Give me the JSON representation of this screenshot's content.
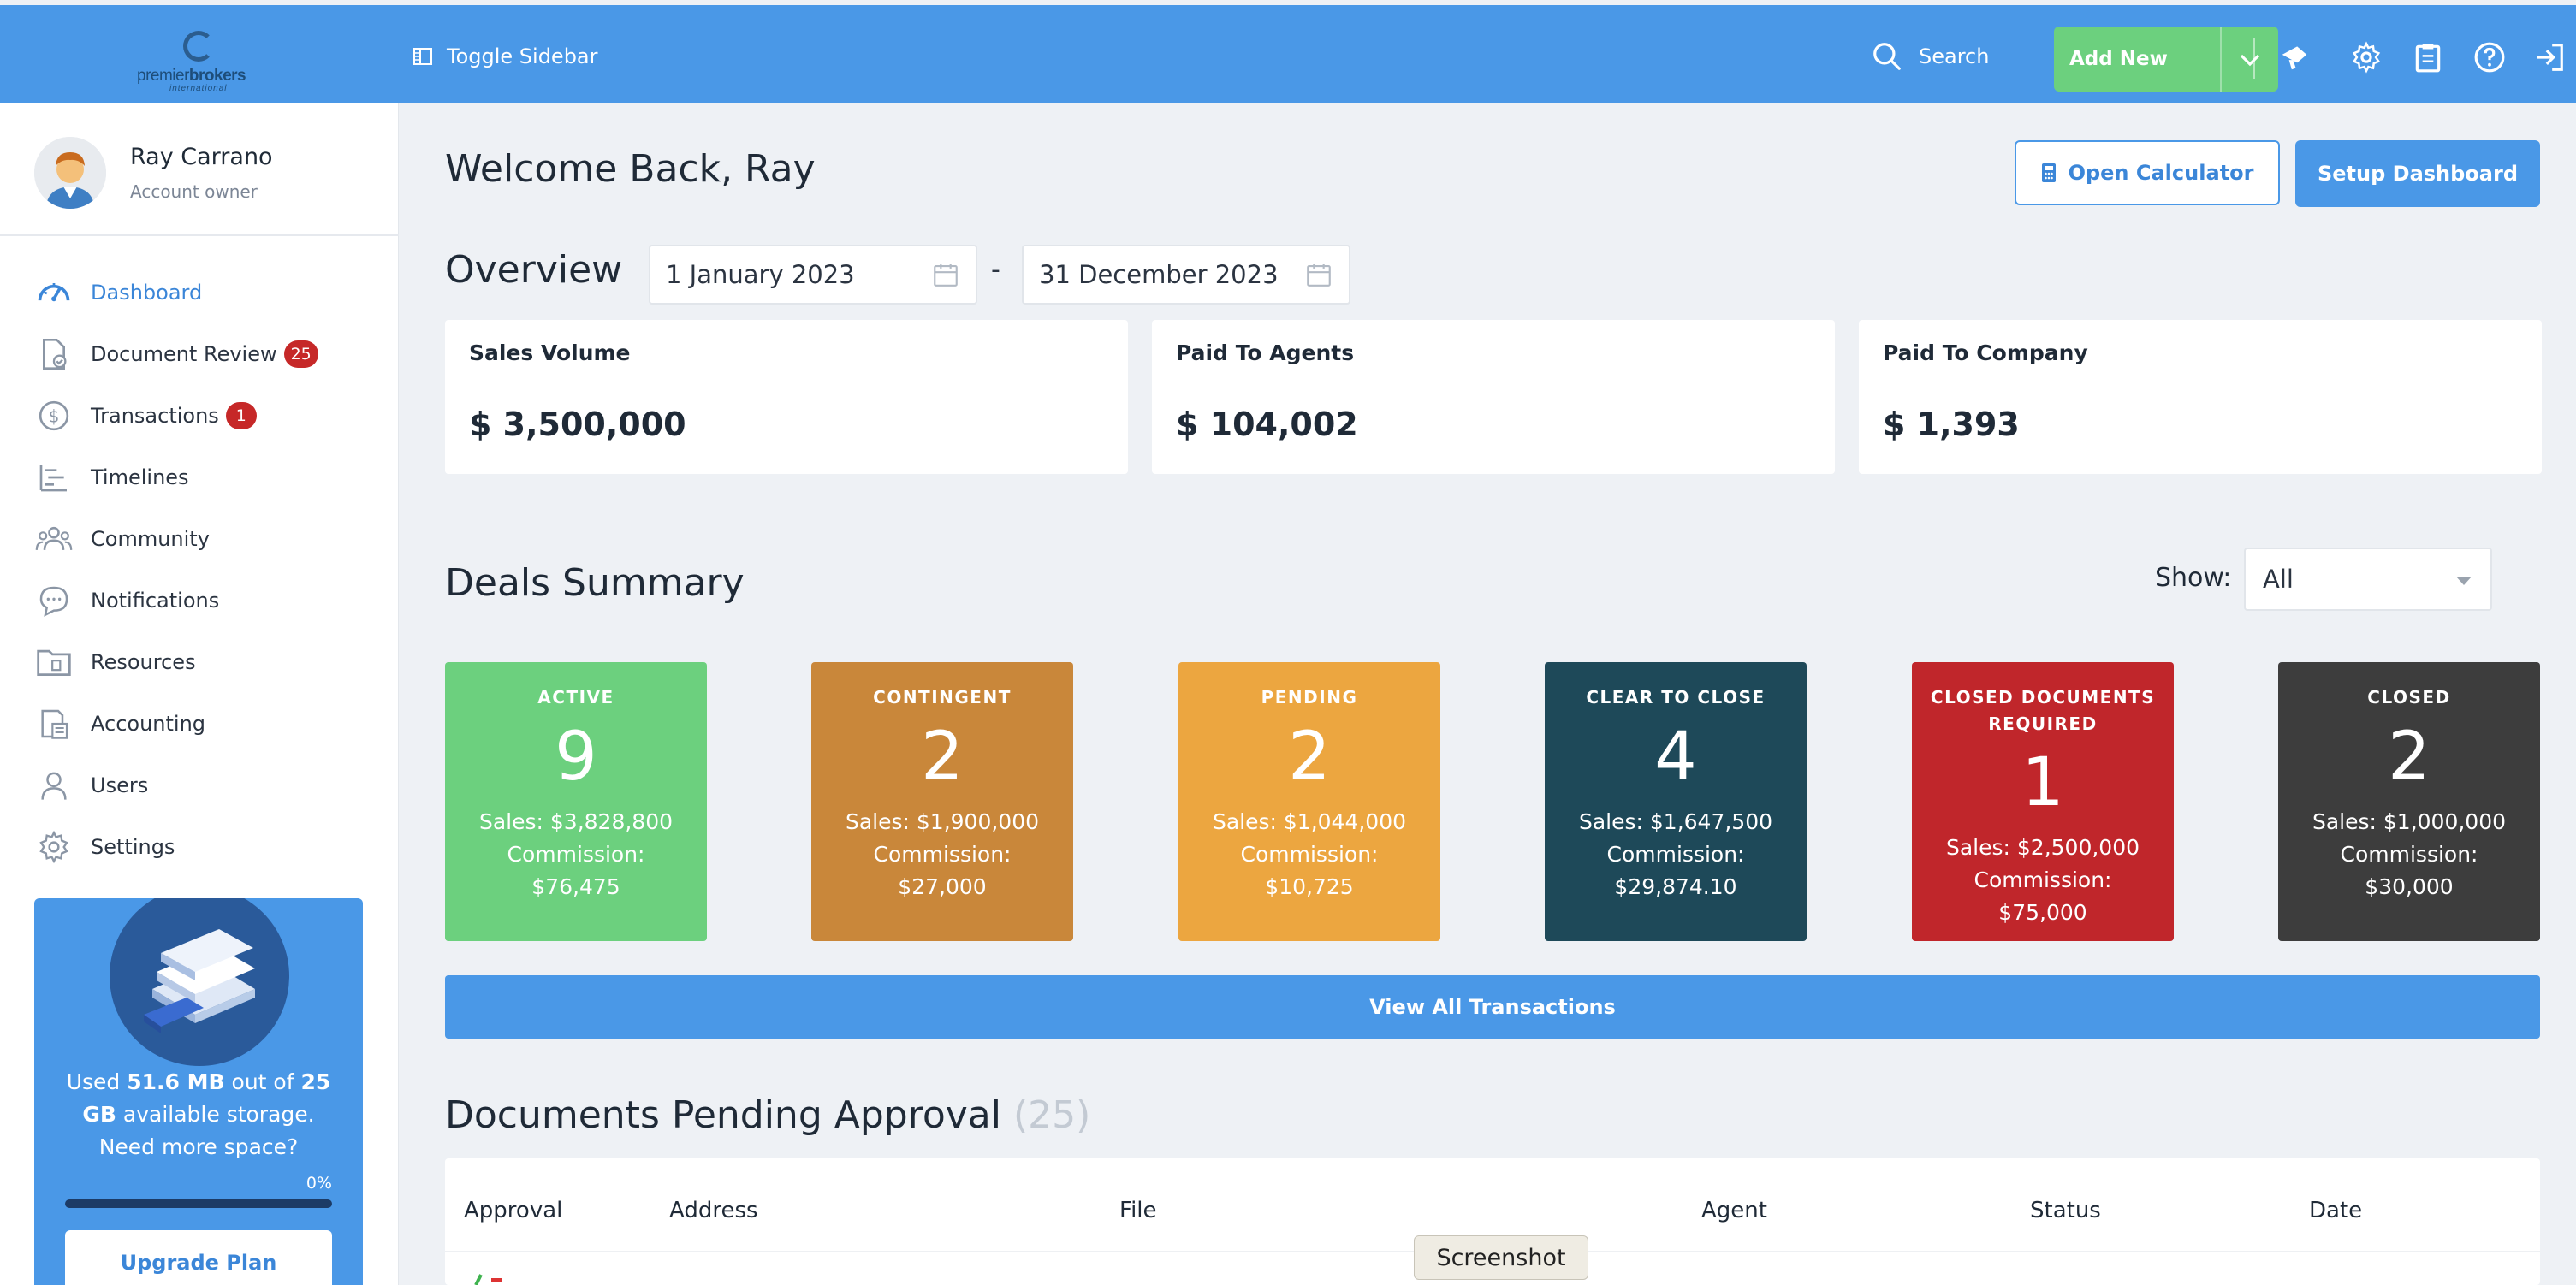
{
  "topbar": {
    "logo": {
      "word_light": "premier",
      "word_bold": "brokers",
      "sub": "international"
    },
    "toggle_sidebar_label": "Toggle Sidebar",
    "search_label": "Search",
    "add_new_label": "Add New",
    "icons": [
      "megaphone-icon",
      "gear-icon",
      "clipboard-icon",
      "help-icon",
      "logout-icon"
    ]
  },
  "user": {
    "name": "Ray Carrano",
    "role": "Account owner"
  },
  "sidebar": {
    "items": [
      {
        "label": "Dashboard",
        "icon": "dashboard-icon",
        "active": true
      },
      {
        "label": "Document Review",
        "icon": "document-check-icon",
        "badge": "25"
      },
      {
        "label": "Transactions",
        "icon": "dollar-circle-icon",
        "badge": "1"
      },
      {
        "label": "Timelines",
        "icon": "timeline-icon"
      },
      {
        "label": "Community",
        "icon": "community-icon"
      },
      {
        "label": "Notifications",
        "icon": "chat-bubble-icon"
      },
      {
        "label": "Resources",
        "icon": "folder-icon"
      },
      {
        "label": "Accounting",
        "icon": "accounting-icon"
      },
      {
        "label": "Users",
        "icon": "user-icon"
      },
      {
        "label": "Settings",
        "icon": "gear-icon"
      }
    ],
    "storage": {
      "used_prefix": "Used ",
      "used": "51.6 MB",
      "middle": " out of ",
      "total": "25 GB",
      "suffix": " available storage.",
      "question": "Need more space?",
      "percent": "0%",
      "percent_value": 0,
      "upgrade_label": "Upgrade Plan"
    }
  },
  "main": {
    "welcome": "Welcome Back, Ray",
    "open_calculator_label": "Open Calculator",
    "setup_dashboard_label": "Setup Dashboard",
    "overview_title": "Overview",
    "date_from": "1 January 2023",
    "date_separator": "-",
    "date_to": "31 December 2023",
    "stats": [
      {
        "label": "Sales Volume",
        "value": "$ 3,500,000"
      },
      {
        "label": "Paid To Agents",
        "value": "$ 104,002"
      },
      {
        "label": "Paid To Company",
        "value": "$ 1,393"
      }
    ],
    "deals_title": "Deals Summary",
    "show_label": "Show:",
    "show_value": "All",
    "deals": [
      {
        "label": "ACTIVE",
        "count": "9",
        "sales": "Sales: $3,828,800",
        "commission_label": "Commission:",
        "commission": "$76,475",
        "color": "#6cd07e"
      },
      {
        "label": "CONTINGENT",
        "count": "2",
        "sales": "Sales: $1,900,000",
        "commission_label": "Commission:",
        "commission": "$27,000",
        "color": "#c9873a"
      },
      {
        "label": "PENDING",
        "count": "2",
        "sales": "Sales: $1,044,000",
        "commission_label": "Commission:",
        "commission": "$10,725",
        "color": "#eca640"
      },
      {
        "label": "CLEAR TO CLOSE",
        "count": "4",
        "sales": "Sales: $1,647,500",
        "commission_label": "Commission:",
        "commission": "$29,874.10",
        "color": "#1e4959"
      },
      {
        "label": "CLOSED DOCUMENTS REQUIRED",
        "count": "1",
        "sales": "Sales: $2,500,000",
        "commission_label": "Commission:",
        "commission": "$75,000",
        "color": "#c0262b"
      },
      {
        "label": "CLOSED",
        "count": "2",
        "sales": "Sales: $1,000,000",
        "commission_label": "Commission:",
        "commission": "$30,000",
        "color": "#3d3d3d"
      }
    ],
    "view_all_label": "View All Transactions",
    "docs_title": "Documents Pending Approval",
    "docs_count": "(25)",
    "table_headers": [
      "Approval",
      "Address",
      "File",
      "Agent",
      "Status",
      "Date"
    ]
  },
  "tooltip": "Screenshot",
  "colors": {
    "primary": "#4a98e7",
    "success": "#6cd07e",
    "badge": "#c62828",
    "background": "#eef1f5"
  }
}
